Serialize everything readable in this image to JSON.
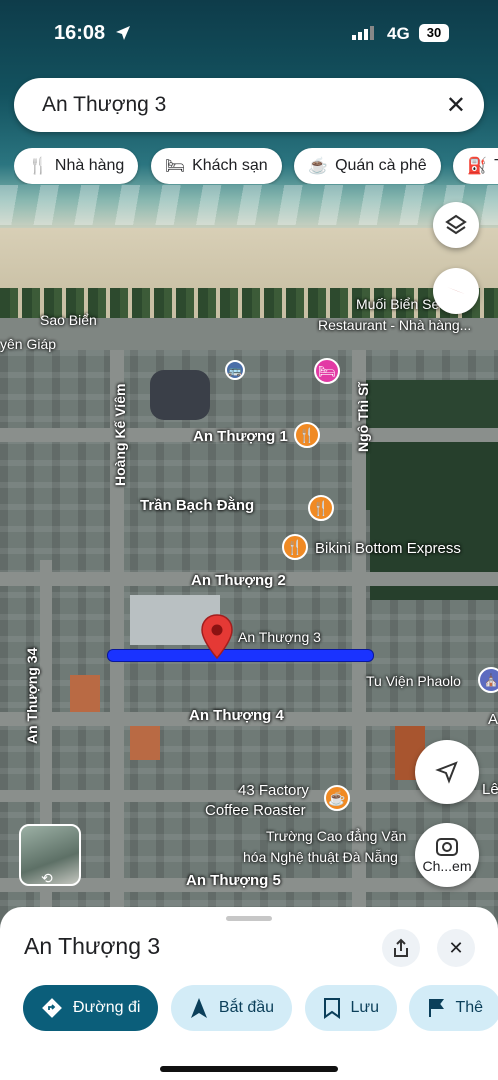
{
  "status_bar": {
    "time": "16:08",
    "network": "4G",
    "battery": "30"
  },
  "search": {
    "query": "An Thượng 3"
  },
  "chips": [
    {
      "icon": "restaurant-icon",
      "label": "Nhà hàng"
    },
    {
      "icon": "hotel-icon",
      "label": "Khách sạn"
    },
    {
      "icon": "coffee-icon",
      "label": "Quán cà phê"
    },
    {
      "icon": "gas-station-icon",
      "label": "Tr"
    }
  ],
  "map": {
    "labels": {
      "sao_bien": "Sao Biển",
      "yen_giap": "yên Giáp",
      "muoi_bien_1": "Muối Biển Se ood",
      "muoi_bien_2": "Restaurant - Nhà hàng...",
      "an_thuong_1": "An Thượng 1",
      "hoang_ke_viem": "Hoàng Kế Viêm",
      "ngo_thi_si": "Ngô Thì Sĩ",
      "tran_bach_dang": "Trần Bạch Đằng",
      "bikini": "Bikini Bottom Express",
      "an_thuong_2": "An Thượng 2",
      "an_thuong_3": "An Thượng 3",
      "an_thuong_34": "An Thượng 34",
      "tu_vien": "Tu Viện Phaolo",
      "an_thuong_4": "An Thượng 4",
      "factory_1": "43 Factory",
      "factory_2": "Coffee Roaster",
      "truong_1": "Trường Cao đẳng Văn",
      "truong_2": "hóa Nghệ thuật Đà Nẵng",
      "an_thuong_5": "An Thượng 5",
      "edge_a": "A",
      "edge_le": "Lê",
      "edge_ch": "Ch...em"
    }
  },
  "sheet": {
    "title": "An Thượng 3",
    "actions": [
      {
        "icon": "directions-icon",
        "label": "Đường đi"
      },
      {
        "icon": "navigation-arrow-icon",
        "label": "Bắt đầu"
      },
      {
        "icon": "bookmark-icon",
        "label": "Lưu"
      },
      {
        "icon": "flag-icon",
        "label": "Thê"
      }
    ]
  },
  "colors": {
    "route": "#1a33ff",
    "primary_action": "#0b5e7a",
    "poi_food": "#f08a24",
    "poi_hotel": "#e33aa5",
    "pin": "#e53935"
  }
}
